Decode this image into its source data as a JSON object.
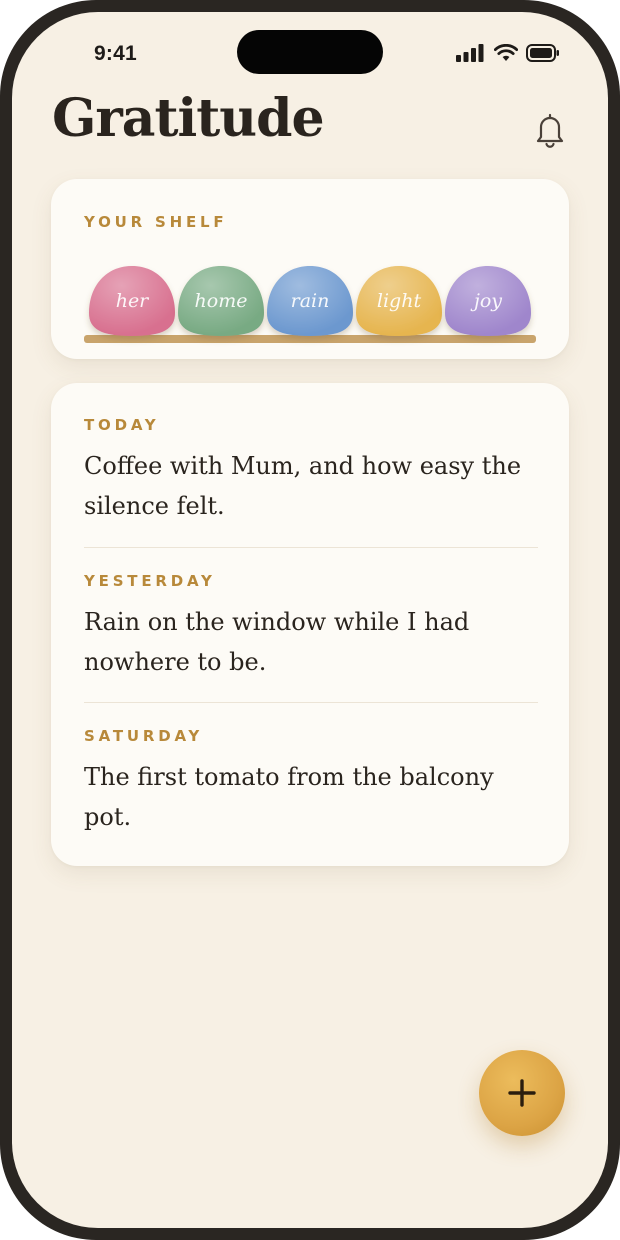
{
  "status_bar": {
    "time": "9:41",
    "icons": [
      "signal-icon",
      "wifi-icon",
      "battery-icon"
    ]
  },
  "header": {
    "title": "Gratitude",
    "notification_icon": "bell-icon"
  },
  "shelf": {
    "label": "YOUR SHELF",
    "stones": [
      {
        "word": "her",
        "color": "#d8708f"
      },
      {
        "word": "home",
        "color": "#78aa83"
      },
      {
        "word": "rain",
        "color": "#6c98cf"
      },
      {
        "word": "light",
        "color": "#e6b54f"
      },
      {
        "word": "joy",
        "color": "#9f86cc"
      }
    ],
    "shelf_color": "#c9a46c"
  },
  "entries": [
    {
      "day": "TODAY",
      "text_lines": [
        "Coffee with Mum, and how easy the",
        "silence felt."
      ]
    },
    {
      "day": "YESTERDAY",
      "text_lines": [
        "Rain on the window while I had",
        "nowhere to be."
      ]
    },
    {
      "day": "SATURDAY",
      "text_lines": [
        "The first tomato from the balcony",
        "pot."
      ]
    }
  ],
  "fab": {
    "icon": "plus-icon",
    "color": "#dca445"
  },
  "colors": {
    "background": "#f7f0e4",
    "card": "#fdfbf6",
    "accent": "#b8893a",
    "text": "#2a241e"
  }
}
